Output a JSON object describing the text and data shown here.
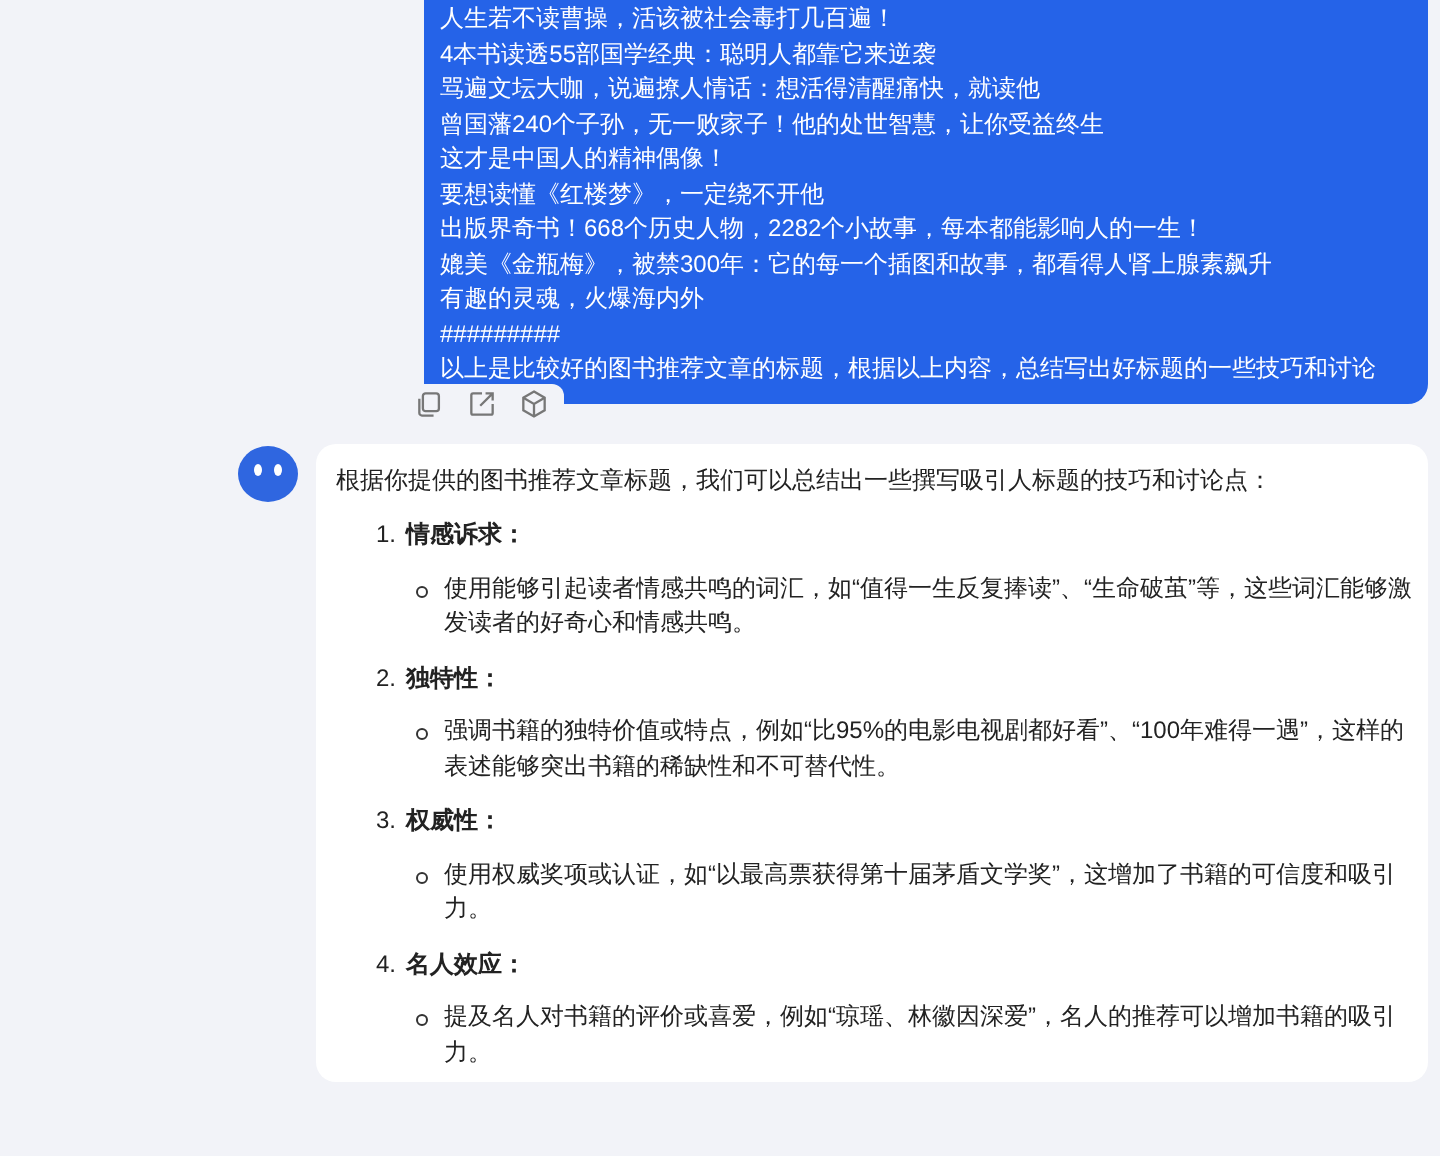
{
  "user_message": {
    "lines": [
      "人生若不读曹操，活该被社会毒打几百遍！",
      "4本书读透55部国学经典：聪明人都靠它来逆袭",
      "骂遍文坛大咖，说遍撩人情话：想活得清醒痛快，就读他",
      "曾国藩240个子孙，无一败家子！他的处世智慧，让你受益终生",
      "这才是中国人的精神偶像！",
      "要想读懂《红楼梦》，一定绕不开他",
      "出版界奇书！668个历史人物，2282个小故事，每本都能影响人的一生！",
      "媲美《金瓶梅》，被禁300年：它的每一个插图和故事，都看得人肾上腺素飙升",
      "有趣的灵魂，火爆海内外",
      "#########",
      "以上是比较好的图书推荐文章的标题，根据以上内容，总结写出好标题的一些技巧和讨论"
    ]
  },
  "message_actions": [
    {
      "kind": "copy"
    },
    {
      "kind": "share"
    },
    {
      "kind": "cube"
    }
  ],
  "reply": {
    "intro": "根据你提供的图书推荐文章标题，我们可以总结出一些撰写吸引人标题的技巧和讨论点：",
    "sections": [
      {
        "number": "1.",
        "title": "情感诉求：",
        "bullets": [
          "使用能够引起读者情感共鸣的词汇，如“值得一生反复捧读”、“生命破茧”等，这些词汇能够激发读者的好奇心和情感共鸣。"
        ]
      },
      {
        "number": "2.",
        "title": "独特性：",
        "bullets": [
          "强调书籍的独特价值或特点，例如“比95%的电影电视剧都好看”、“100年难得一遇”，这样的表述能够突出书籍的稀缺性和不可替代性。"
        ]
      },
      {
        "number": "3.",
        "title": "权威性：",
        "bullets": [
          "使用权威奖项或认证，如“以最高票获得第十届茅盾文学奖”，这增加了书籍的可信度和吸引力。"
        ]
      },
      {
        "number": "4.",
        "title": "名人效应：",
        "bullets": [
          "提及名人对书籍的评价或喜爱，例如“琼瑶、林徽因深爱”，名人的推荐可以增加书籍的吸引力。"
        ]
      }
    ]
  }
}
